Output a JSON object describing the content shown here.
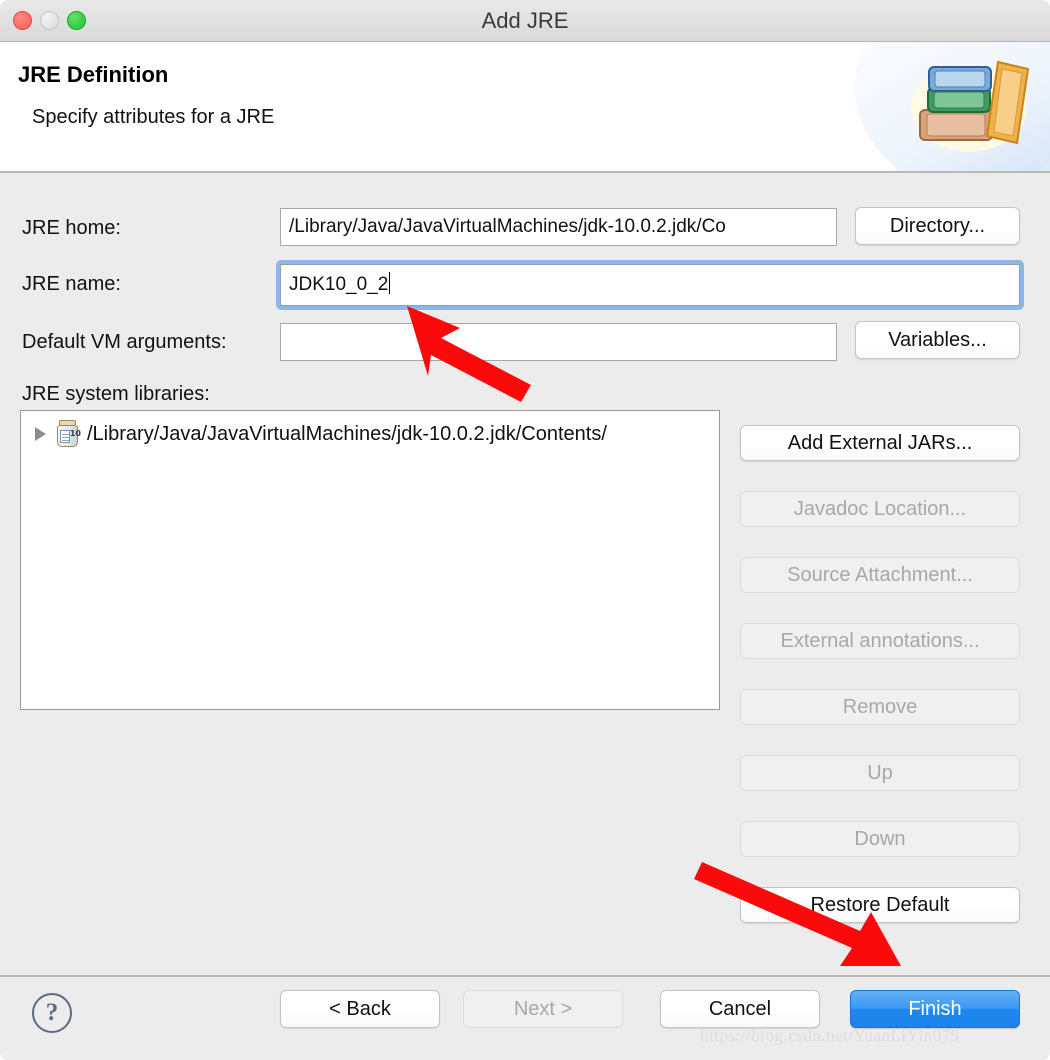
{
  "window": {
    "title": "Add JRE",
    "traffic_lights": [
      "close-button",
      "minimize-button",
      "maximize-button"
    ]
  },
  "header": {
    "title": "JRE Definition",
    "subtitle": "Specify attributes for a JRE",
    "artwork": "books-stack-icon"
  },
  "form": {
    "jre_home": {
      "label": "JRE home:",
      "value": "/Library/Java/JavaVirtualMachines/jdk-10.0.2.jdk/Co",
      "button": "Directory..."
    },
    "jre_name": {
      "label": "JRE name:",
      "value": "JDK10_0_2",
      "focused": true
    },
    "vm_args": {
      "label": "Default VM arguments:",
      "value": "",
      "placeholder": "",
      "button": "Variables..."
    },
    "libraries": {
      "label": "JRE system libraries:",
      "rows": [
        {
          "icon": "jar-icon",
          "text": "/Library/Java/JavaVirtualMachines/jdk-10.0.2.jdk/Contents/",
          "expanded": false
        }
      ]
    }
  },
  "side_buttons": [
    {
      "label": "Add External JARs...",
      "enabled": true
    },
    {
      "label": "Javadoc Location...",
      "enabled": false
    },
    {
      "label": "Source Attachment...",
      "enabled": false
    },
    {
      "label": "External annotations...",
      "enabled": false
    },
    {
      "label": "Remove",
      "enabled": false
    },
    {
      "label": "Up",
      "enabled": false
    },
    {
      "label": "Down",
      "enabled": false
    },
    {
      "label": "Restore Default",
      "enabled": true
    }
  ],
  "footer": {
    "help": "?",
    "buttons": [
      {
        "label": "< Back",
        "enabled": true,
        "primary": false
      },
      {
        "label": "Next >",
        "enabled": false,
        "primary": false
      },
      {
        "label": "Cancel",
        "enabled": true,
        "primary": false
      },
      {
        "label": "Finish",
        "enabled": true,
        "primary": true
      }
    ],
    "watermark": "https://blog.csdn.net/YuanLiYin079"
  },
  "annotations": {
    "arrow_color": "#FA0A0A",
    "arrow_1_target": "jre-name-input",
    "arrow_2_target": "finish-button"
  },
  "colors": {
    "dialog_background": "#ECECEC",
    "header_background": "#FFFFFF",
    "focus_ring": "#87B8E8",
    "primary_button": "#1E88F0",
    "arrow_red": "#FA0A0A"
  }
}
